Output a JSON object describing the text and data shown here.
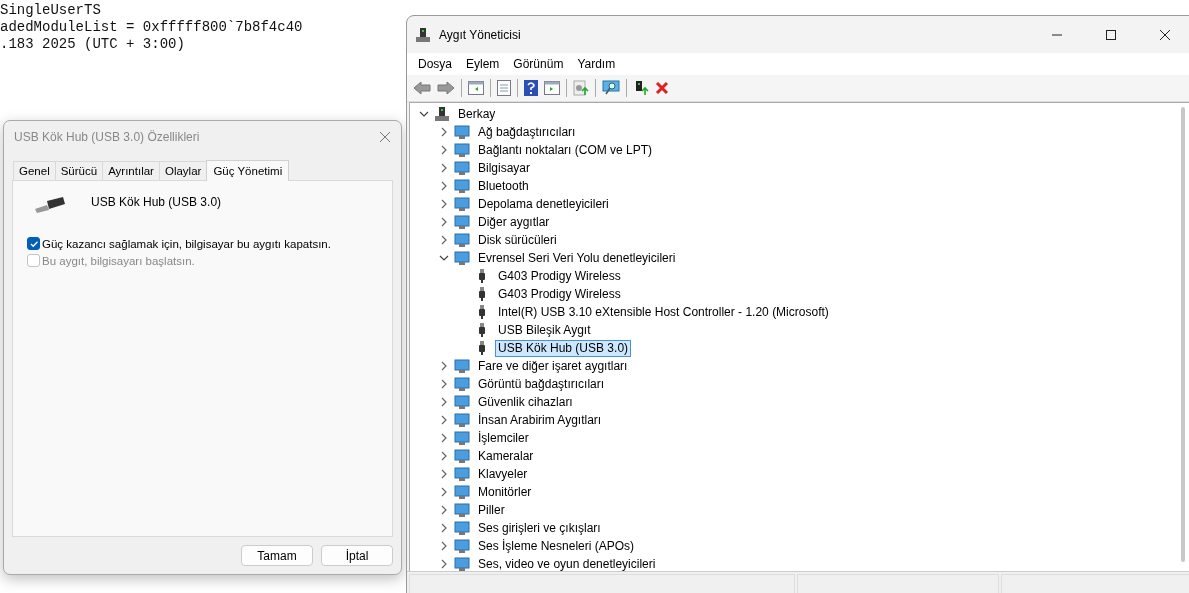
{
  "background_editor": {
    "lines": [
      "SingleUserTS",
      "adedModuleList = 0xfffff800`7b8f4c40",
      ".183 2025 (UTC + 3:00)"
    ]
  },
  "properties_dialog": {
    "title": "USB Kök Hub (USB 3.0) Özellikleri",
    "tabs": [
      {
        "label": "Genel",
        "selected": false
      },
      {
        "label": "Sürücü",
        "selected": false
      },
      {
        "label": "Ayrıntılar",
        "selected": false
      },
      {
        "label": "Olaylar",
        "selected": false
      },
      {
        "label": "Güç Yönetimi",
        "selected": true
      }
    ],
    "device_name": "USB Kök Hub (USB 3.0)",
    "options": [
      {
        "label": "Güç kazancı sağlamak için, bilgisayar bu aygıtı kapatsın.",
        "checked": true,
        "disabled": false
      },
      {
        "label": "Bu aygıt, bilgisayarı başlatsın.",
        "checked": false,
        "disabled": true
      }
    ],
    "buttons": [
      "Tamam",
      "İptal"
    ]
  },
  "device_manager": {
    "title": "Aygıt Yöneticisi",
    "menu": [
      "Dosya",
      "Eylem",
      "Görünüm",
      "Yardım"
    ],
    "tree": {
      "label": "Berkay",
      "expanded": true,
      "selected": false,
      "children": [
        {
          "label": "Ağ bağdaştırıcıları",
          "expanded": false,
          "selected": false
        },
        {
          "label": "Bağlantı noktaları (COM ve LPT)",
          "expanded": false,
          "selected": false
        },
        {
          "label": "Bilgisayar",
          "expanded": false,
          "selected": false
        },
        {
          "label": "Bluetooth",
          "expanded": false,
          "selected": false
        },
        {
          "label": "Depolama denetleyicileri",
          "expanded": false,
          "selected": false
        },
        {
          "label": "Diğer aygıtlar",
          "expanded": false,
          "selected": false
        },
        {
          "label": "Disk sürücüleri",
          "expanded": false,
          "selected": false
        },
        {
          "label": "Evrensel Seri Veri Yolu denetleyicileri",
          "expanded": true,
          "selected": false,
          "children": [
            {
              "label": "G403 Prodigy Wireless",
              "selected": false
            },
            {
              "label": "G403 Prodigy Wireless",
              "selected": false
            },
            {
              "label": "Intel(R) USB 3.10 eXtensible Host Controller - 1.20 (Microsoft)",
              "selected": false
            },
            {
              "label": "USB Bileşik Aygıt",
              "selected": false
            },
            {
              "label": "USB Kök Hub (USB 3.0)",
              "selected": true
            }
          ]
        },
        {
          "label": "Fare ve diğer işaret aygıtları",
          "expanded": false,
          "selected": false
        },
        {
          "label": "Görüntü bağdaştırıcıları",
          "expanded": false,
          "selected": false
        },
        {
          "label": "Güvenlik cihazları",
          "expanded": false,
          "selected": false
        },
        {
          "label": "İnsan Arabirim Aygıtları",
          "expanded": false,
          "selected": false
        },
        {
          "label": "İşlemciler",
          "expanded": false,
          "selected": false
        },
        {
          "label": "Kameralar",
          "expanded": false,
          "selected": false
        },
        {
          "label": "Klavyeler",
          "expanded": false,
          "selected": false
        },
        {
          "label": "Monitörler",
          "expanded": false,
          "selected": false
        },
        {
          "label": "Piller",
          "expanded": false,
          "selected": false
        },
        {
          "label": "Ses girişleri ve çıkışları",
          "expanded": false,
          "selected": false
        },
        {
          "label": "Ses İşleme Nesneleri (APOs)",
          "expanded": false,
          "selected": false
        },
        {
          "label": "Ses, video ve oyun denetleyicileri",
          "expanded": false,
          "selected": false
        }
      ]
    }
  }
}
